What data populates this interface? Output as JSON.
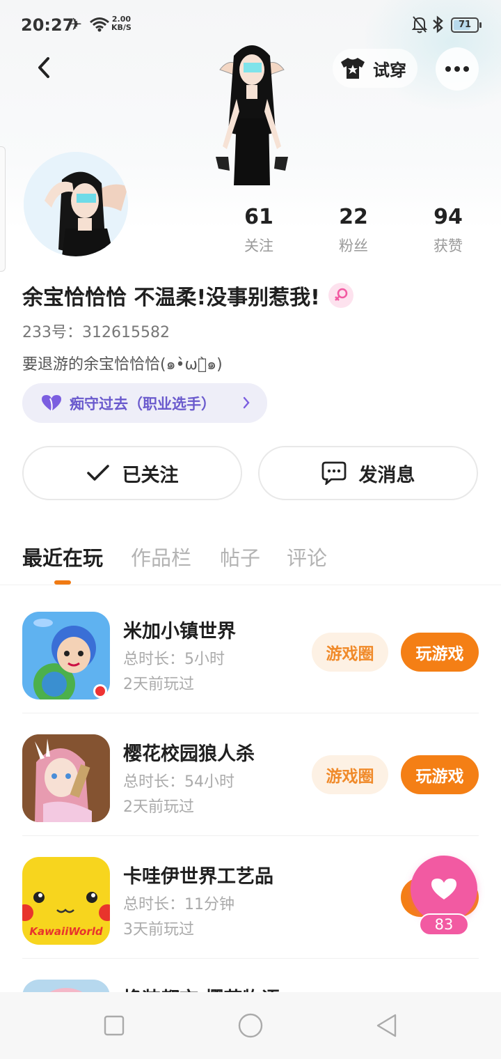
{
  "status_bar": {
    "time": "20:27",
    "speed_value": "2.00",
    "speed_unit": "KB/S",
    "battery": "71",
    "battery_level": 0.71
  },
  "header": {
    "tryon_label": "试穿"
  },
  "profile": {
    "stats": [
      {
        "value": "61",
        "label": "关注"
      },
      {
        "value": "22",
        "label": "粉丝"
      },
      {
        "value": "94",
        "label": "获赞"
      }
    ],
    "username": "余宝恰恰恰 不温柔!没事别惹我!",
    "uid": "233号：312615582",
    "bio": "要退游的余宝恰恰恰(๑•̀ωก̀๑)",
    "title_tag": "痴守过去（职业选手）",
    "follow_label": "已关注",
    "message_label": "发消息"
  },
  "tabs": [
    "最近在玩",
    "作品栏",
    "帖子",
    "评论"
  ],
  "active_tab": 0,
  "games": [
    {
      "name": "米加小镇世界",
      "duration": "总时长：5小时",
      "last_played": "2天前玩过",
      "circle_label": "游戏圈",
      "play_label": "玩游戏"
    },
    {
      "name": "樱花校园狼人杀",
      "duration": "总时长：54小时",
      "last_played": "2天前玩过",
      "circle_label": "游戏圈",
      "play_label": "玩游戏"
    },
    {
      "name": "卡哇伊世界工艺品",
      "duration": "总时长：11分钟",
      "last_played": "3天前玩过",
      "icon_text": "KawaiiWorld"
    },
    {
      "name": "换装都市 樱花物语"
    }
  ],
  "like_count": "83",
  "colors": {
    "accent": "#f47f15",
    "like": "#f25aa2",
    "tag_text": "#6a5acd"
  }
}
